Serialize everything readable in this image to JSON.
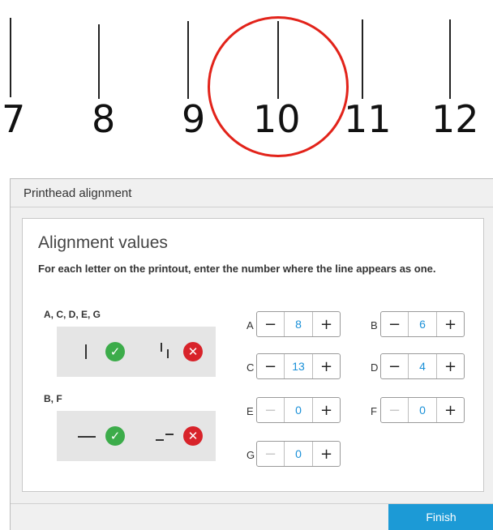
{
  "ruler": {
    "numbers": [
      "7",
      "8",
      "9",
      "10",
      "11",
      "12"
    ],
    "highlighted": "10",
    "highlight_color": "#e2231a"
  },
  "dialog": {
    "title": "Printhead alignment",
    "panel_title": "Alignment values",
    "instructions": "For each letter on the printout, enter the number where the line appears as one.",
    "groups": [
      {
        "label": "A, C, D, E, G",
        "correct_icon": "check-icon",
        "wrong_icon": "x-icon"
      },
      {
        "label": "B, F",
        "correct_icon": "check-icon",
        "wrong_icon": "x-icon"
      }
    ],
    "fields": [
      {
        "letter": "A",
        "value": "8",
        "minus": "−",
        "plus": "+"
      },
      {
        "letter": "B",
        "value": "6",
        "minus": "−",
        "plus": "+"
      },
      {
        "letter": "C",
        "value": "13",
        "minus": "−",
        "plus": "+"
      },
      {
        "letter": "D",
        "value": "4",
        "minus": "−",
        "plus": "+"
      },
      {
        "letter": "E",
        "value": "0",
        "minus": "−",
        "plus": "+"
      },
      {
        "letter": "F",
        "value": "0",
        "minus": "−",
        "plus": "+"
      },
      {
        "letter": "G",
        "value": "0",
        "minus": "−",
        "plus": "+"
      }
    ],
    "finish_label": "Finish",
    "colors": {
      "accent": "#1c9ad6",
      "ok": "#3cac4a",
      "error": "#d8232a",
      "value": "#1a90d8"
    }
  }
}
